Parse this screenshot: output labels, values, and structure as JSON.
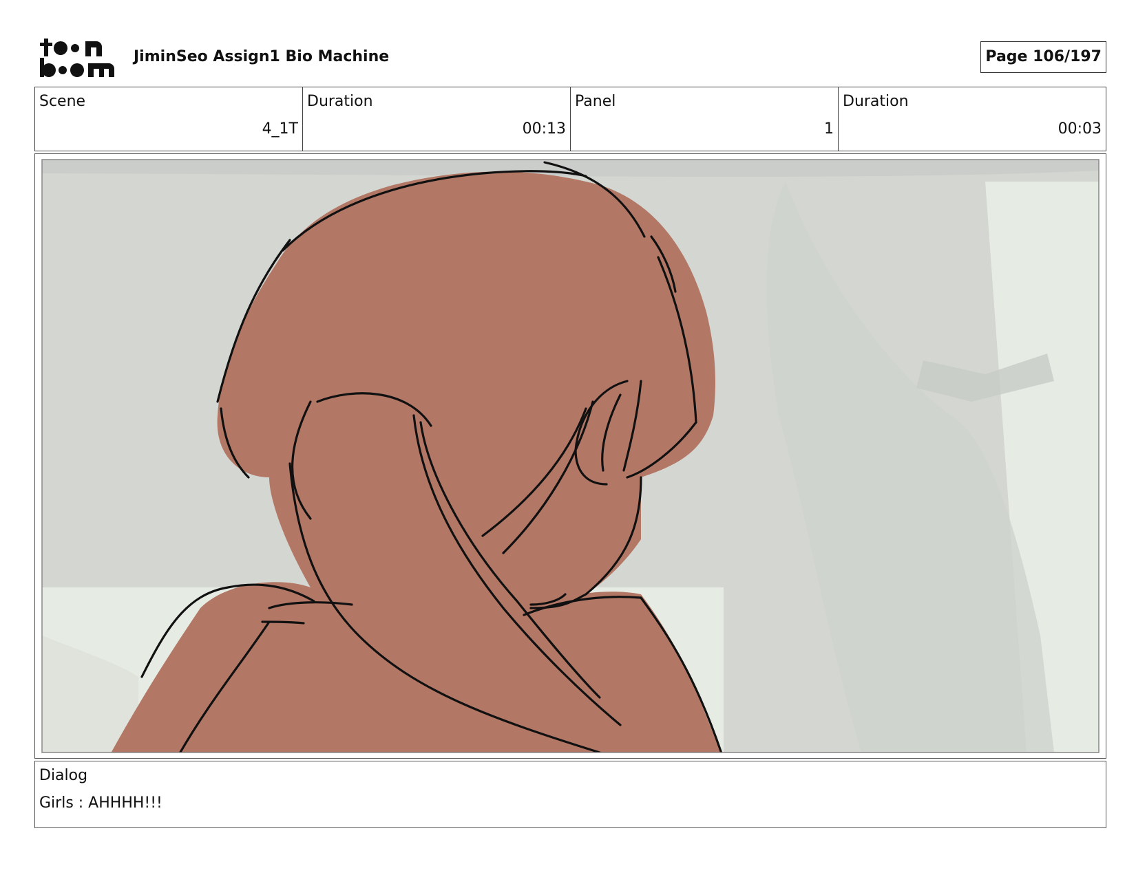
{
  "header": {
    "logo_text": "toonboom",
    "project_title": "JiminSeo Assign1 Bio Machine",
    "page_label": "Page 106/197"
  },
  "info": {
    "scene_label": "Scene",
    "scene_value": "4_1T",
    "scene_duration_label": "Duration",
    "scene_duration_value": "00:13",
    "panel_label": "Panel",
    "panel_value": "1",
    "panel_duration_label": "Duration",
    "panel_duration_value": "00:03"
  },
  "dialog": {
    "label": "Dialog",
    "text": "Girls : AHHHH!!!"
  },
  "colors": {
    "skin": "#b37766",
    "background": "#d5d8d3",
    "background_light": "#e6ebe3",
    "line": "#111111"
  }
}
